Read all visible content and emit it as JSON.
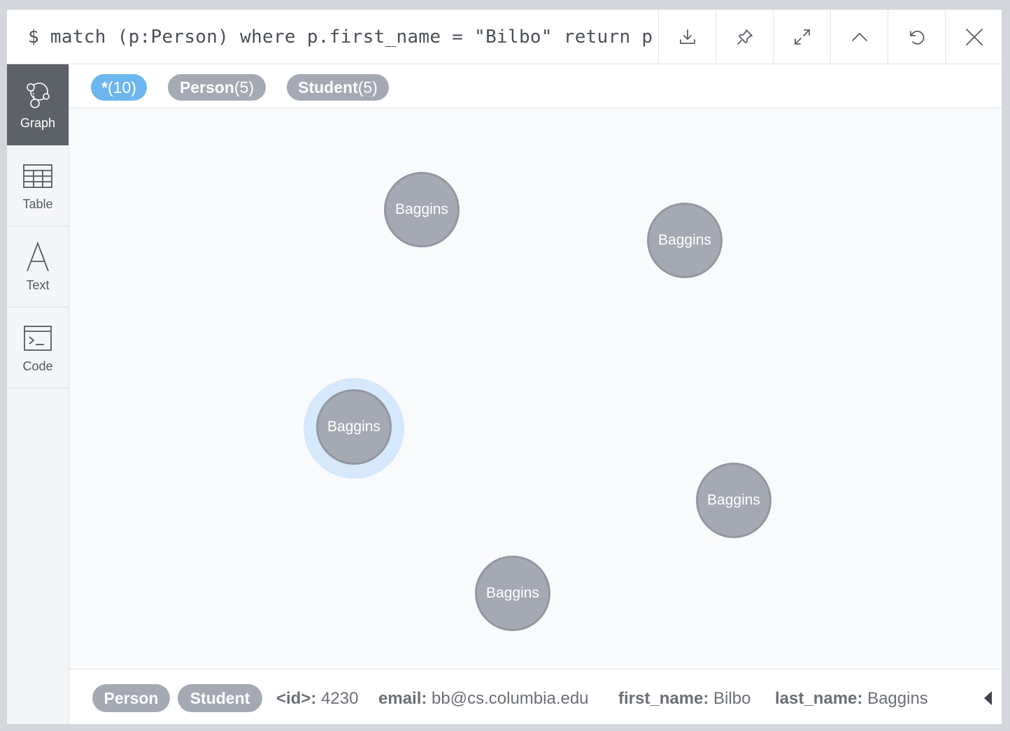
{
  "header": {
    "query": "$ match (p:Person) where p.first_name = \"Bilbo\" return p"
  },
  "sidebar": {
    "items": [
      {
        "label": "Graph"
      },
      {
        "label": "Table"
      },
      {
        "label": "Text"
      },
      {
        "label": "Code"
      }
    ]
  },
  "labels": {
    "all": {
      "name": "*",
      "count": "(10)"
    },
    "person": {
      "name": "Person",
      "count": "(5)"
    },
    "student": {
      "name": "Student",
      "count": "(5)"
    }
  },
  "nodes": [
    {
      "caption": "Baggins"
    },
    {
      "caption": "Baggins"
    },
    {
      "caption": "Baggins"
    },
    {
      "caption": "Baggins"
    },
    {
      "caption": "Baggins"
    }
  ],
  "footer": {
    "tags": [
      "Person",
      "Student"
    ],
    "props": [
      {
        "key": "<id>:",
        "value": "4230"
      },
      {
        "key": "email:",
        "value": "bb@cs.columbia.edu"
      },
      {
        "key": "first_name:",
        "value": "Bilbo"
      },
      {
        "key": "last_name:",
        "value": "Baggins"
      }
    ]
  },
  "colors": {
    "accent": "#6cb6f0",
    "node": "#a5a9b3",
    "halo": "#d6e8fb",
    "sidebar_active": "#5d6168"
  }
}
